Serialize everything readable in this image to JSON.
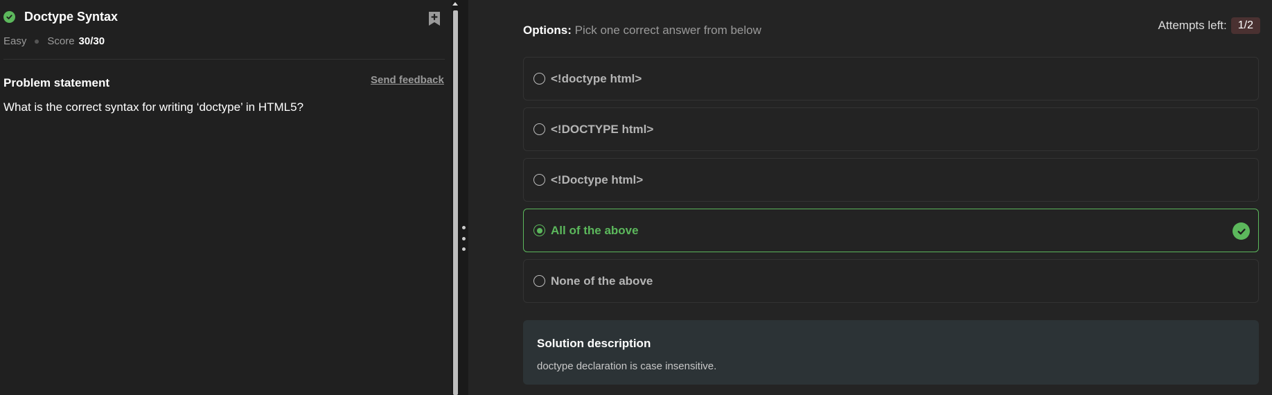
{
  "problem": {
    "title": "Doctype Syntax",
    "difficulty": "Easy",
    "score_label": "Score",
    "score_value": "30/30",
    "statement_heading": "Problem statement",
    "feedback_link": "Send feedback",
    "question": "What is the correct syntax for writing ‘doctype’ in HTML5?"
  },
  "options_header": {
    "label": "Options:",
    "instruction": "Pick one correct answer from below",
    "attempts_label": "Attempts left:",
    "attempts_value": "1/2"
  },
  "options": [
    {
      "text": "<!doctype html>",
      "selected": false
    },
    {
      "text": "<!DOCTYPE html>",
      "selected": false
    },
    {
      "text": "<!Doctype html>",
      "selected": false
    },
    {
      "text": "All of the above",
      "selected": true,
      "correct": true
    },
    {
      "text": "None of the above",
      "selected": false
    }
  ],
  "solution": {
    "title": "Solution description",
    "text": "doctype declaration is case insensitive."
  },
  "colors": {
    "accent_green": "#5cb85c",
    "attempts_badge": "#4a3131",
    "solution_bg": "#2c3336"
  }
}
